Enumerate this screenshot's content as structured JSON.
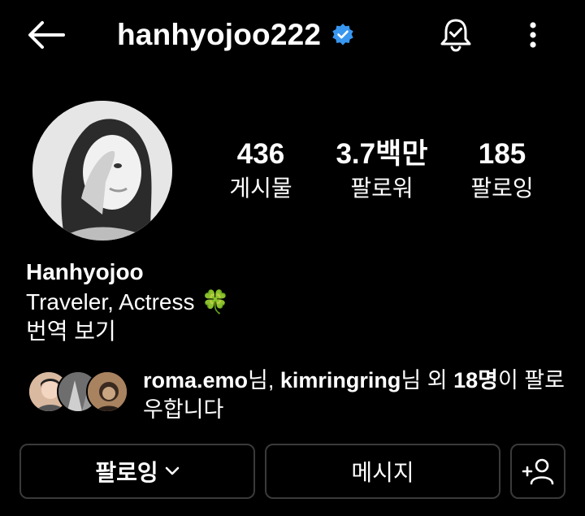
{
  "header": {
    "username": "hanhyojoo222",
    "verified": true,
    "icons": [
      "back-arrow-icon",
      "verified-badge-icon",
      "bell-icon",
      "more-vertical-icon"
    ],
    "accent_color": "#3897f0"
  },
  "stats": {
    "posts": {
      "value": "436",
      "label": "게시물"
    },
    "followers": {
      "value": "3.7백만",
      "label": "팔로워"
    },
    "following": {
      "value": "185",
      "label": "팔로잉"
    }
  },
  "bio": {
    "name": "Hanhyojoo",
    "description": "Traveler, Actress",
    "emoji": "🍀",
    "translate": "번역 보기"
  },
  "mutual": {
    "user1": "roma.emo",
    "sep1": "님, ",
    "user2": "kimringring",
    "sep2": "님 외 ",
    "count": "18명",
    "rest": "이 팔로우합니다"
  },
  "actions": {
    "following": "팔로잉",
    "message": "메시지"
  }
}
